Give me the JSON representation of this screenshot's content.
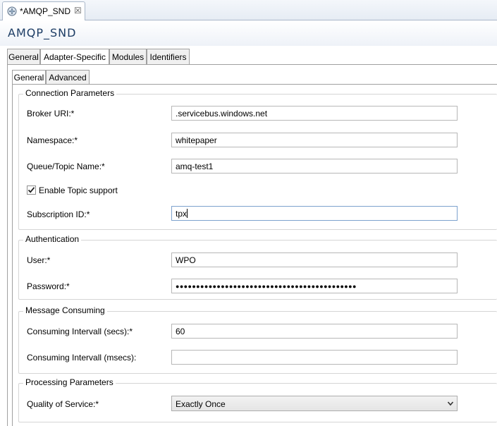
{
  "editor_tab": {
    "label": "*AMQP_SND",
    "close_glyph": "☒"
  },
  "header": {
    "title": "AMQP_SND"
  },
  "outer_tabs": [
    {
      "label": "General",
      "active": false
    },
    {
      "label": "Adapter-Specific",
      "active": true
    },
    {
      "label": "Modules",
      "active": false
    },
    {
      "label": "Identifiers",
      "active": false
    }
  ],
  "inner_tabs": [
    {
      "label": "General",
      "active": true
    },
    {
      "label": "Advanced",
      "active": false
    }
  ],
  "connection": {
    "title": "Connection Parameters",
    "broker_uri": {
      "label": "Broker URI:*",
      "value": ".servicebus.windows.net"
    },
    "namespace": {
      "label": "Namespace:*",
      "value": "whitepaper"
    },
    "queue_topic": {
      "label": "Queue/Topic Name:*",
      "value": "amq-test1"
    },
    "enable_topic": {
      "label": "Enable Topic support",
      "checked": true
    },
    "subscription": {
      "label": "Subscription ID:*",
      "value": "tpx"
    }
  },
  "authentication": {
    "title": "Authentication",
    "user": {
      "label": "User:*",
      "value": "WPO"
    },
    "password": {
      "label": "Password:*",
      "masked": "●●●●●●●●●●●●●●●●●●●●●●●●●●●●●●●●●●●●●●●●●●●●"
    }
  },
  "consuming": {
    "title": "Message Consuming",
    "secs": {
      "label": "Consuming Intervall (secs):*",
      "value": "60"
    },
    "msecs": {
      "label": "Consuming Intervall (msecs):",
      "value": ""
    }
  },
  "processing": {
    "title": "Processing Parameters",
    "qos": {
      "label": "Quality of Service:*",
      "value": "Exactly Once"
    }
  },
  "icons": {
    "tab_icon": "integration-channel-icon",
    "dropdown": "chevron-down-icon"
  },
  "colors": {
    "title": "#1d3d65",
    "tab_border": "#a0a0a0",
    "focus_border": "#7da2ce"
  }
}
